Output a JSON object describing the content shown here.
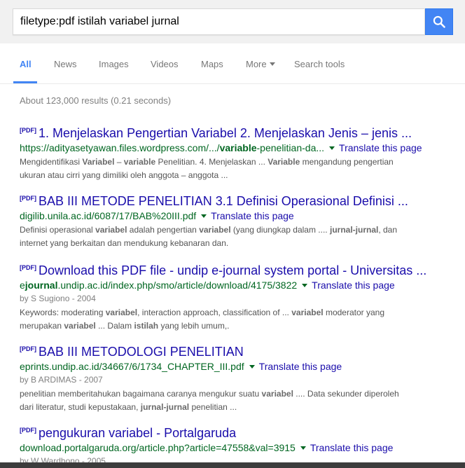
{
  "search": {
    "query": "filetype:pdf istilah variabel jurnal"
  },
  "tabs": [
    {
      "label": "All",
      "active": true
    },
    {
      "label": "News"
    },
    {
      "label": "Images"
    },
    {
      "label": "Videos"
    },
    {
      "label": "Maps"
    },
    {
      "label": "More"
    },
    {
      "label": "Search tools"
    }
  ],
  "stats": "About 123,000 results (0.21 seconds)",
  "colors": {
    "accent": "#4285f4",
    "title_link": "#1a0dab",
    "url_green": "#006621"
  },
  "results": [
    {
      "tag": "[PDF]",
      "title": "1. Menjelaskan Pengertian Variabel 2. Menjelaskan Jenis – jenis ...",
      "url_parts": [
        "https://adityasetyawan.files.wordpress.com/.../",
        "variable",
        "-penelitian-da..."
      ],
      "translate": "Translate this page",
      "snippet_line1": [
        "Mengidentifikasi ",
        "Variabel",
        " – ",
        "variable",
        " Penelitian. 4. Menjelaskan ... ",
        "Variable",
        " mengandung pengertian"
      ],
      "snippet_line2": [
        "ukuran atau cirri yang dimiliki oleh anggota – anggota ..."
      ]
    },
    {
      "tag": "[PDF]",
      "title": "BAB III METODE PENELITIAN 3.1 Definisi Operasional Definisi ...",
      "url": "digilib.unila.ac.id/6087/17/BAB%20III.pdf",
      "translate": "Translate this page",
      "snippet_line1": [
        "Definisi operasional ",
        "variabel",
        " adalah pengertian ",
        "variabel",
        " (yang diungkap dalam .... ",
        "jurnal-jurnal",
        ", dan"
      ],
      "snippet_line2": [
        "internet yang berkaitan dan mendukung kebanaran dan."
      ]
    },
    {
      "tag": "[PDF]",
      "title": "Download this PDF file - undip e-journal system portal - Universitas ...",
      "url_parts": [
        "e",
        "journal",
        ".undip.ac.id/index.php/smo/article/download/4175/3822"
      ],
      "translate": "Translate this page",
      "meta": "by S Sugiono - 2004",
      "snippet_line1": [
        "Keywords: moderating ",
        "variabel",
        ", interaction approach, classification of ... ",
        "variabel",
        " moderator yang"
      ],
      "snippet_line2": [
        "merupakan ",
        "variabel",
        " ... Dalam ",
        "istilah",
        " yang lebih umum,."
      ]
    },
    {
      "tag": "[PDF]",
      "title": "BAB III METODOLOGI PENELITIAN",
      "url": "eprints.undip.ac.id/34667/6/1734_CHAPTER_III.pdf",
      "translate": "Translate this page",
      "meta": "by B ARDIMAS - 2007",
      "snippet_line1": [
        "penelitian memberitahukan bagaimana caranya mengukur suatu ",
        "variabel",
        " .... Data sekunder diperoleh"
      ],
      "snippet_line2": [
        "dari literatur, studi kepustakaan, ",
        "jurnal-jurnal",
        " penelitian ..."
      ]
    },
    {
      "tag": "[PDF]",
      "title": "pengukuran variabel - Portalgaruda",
      "url": "download.portalgaruda.org/article.php?article=47558&val=3915",
      "translate": "Translate this page",
      "meta": "by W Wardhono - 2005"
    }
  ]
}
